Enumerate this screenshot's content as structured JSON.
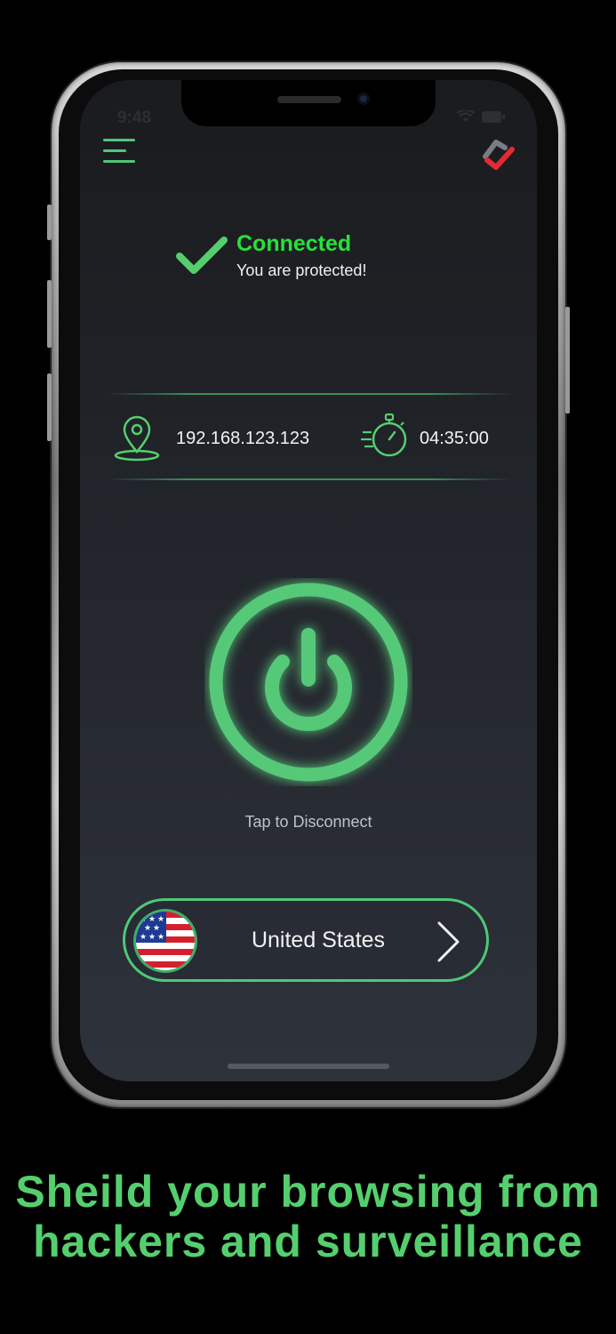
{
  "status_bar": {
    "time": "9:48"
  },
  "connection": {
    "title": "Connected",
    "subtitle": "You are protected!"
  },
  "info": {
    "ip": "192.168.123.123",
    "duration": "04:35:00"
  },
  "power": {
    "label": "Tap to Disconnect"
  },
  "country": {
    "name": "United States"
  },
  "tagline": {
    "line1": "Sheild your browsing from",
    "line2": "hackers and surveillance"
  },
  "colors": {
    "accent": "#4fc878",
    "connected": "#28e13a",
    "background": "#000000"
  }
}
